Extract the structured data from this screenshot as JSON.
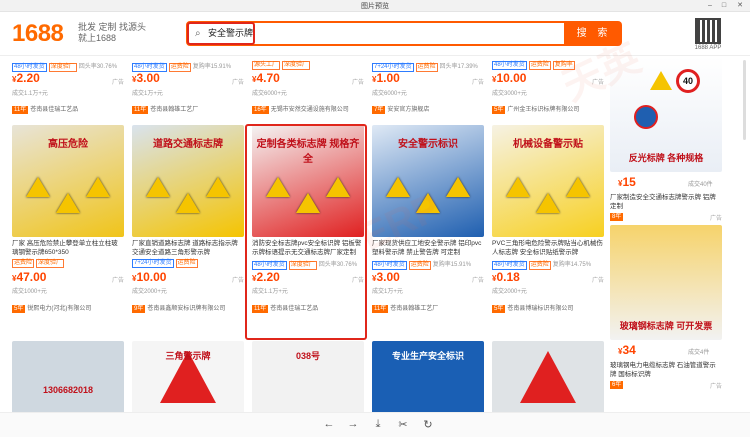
{
  "window": {
    "title": "图片预览"
  },
  "header": {
    "logo": "1688",
    "slogan": "批发 定制 找源头 就上1688",
    "search_value": "安全警示牌",
    "search_button": "搜 索",
    "qr_label": "1688 APP"
  },
  "row1": [
    {
      "price": "2.20",
      "sold": "成交1.1万+元",
      "shop": "苍南县佳瑞工艺品",
      "yr": "11年",
      "tags": [
        "48小时发货",
        "深度验厂",
        "回头率30.76%"
      ]
    },
    {
      "price": "3.00",
      "sold": "成交1万+元",
      "shop": "苍南县翰雄工艺厂",
      "yr": "11年",
      "tags": [
        "48小时发货",
        "运费险",
        "复购率15.91%"
      ]
    },
    {
      "price": "4.70",
      "sold": "成交6000+元",
      "shop": "无锡市安然交通设施有限公司",
      "yr": "16年",
      "tags": [
        "源头工厂",
        "深度验厂"
      ]
    },
    {
      "price": "1.00",
      "sold": "成交6000+元",
      "shop": "安安官方旗舰店",
      "yr": "7年",
      "tags": [
        "7+24小时发货",
        "运费险",
        "回头率17.39%"
      ]
    },
    {
      "price": "10.00",
      "sold": "成交3000+元",
      "shop": "广州金王标识标牌有限公司",
      "yr": "5年",
      "tags": [
        "48小时发货",
        "运费险",
        "复购率"
      ]
    }
  ],
  "row2": [
    {
      "title": "厂家 高压危险禁止攀登单立柱立柱玻璃钢警示牌650*350",
      "price": "47.00",
      "sold": "成交1000+元",
      "shop": "锐熙电力(河北)有限公司",
      "yr": "5年",
      "tags": [
        "运费险",
        "深度验厂"
      ],
      "img": "高压危险"
    },
    {
      "title": "厂家直销道路标志牌 道路标志指示牌 交通安全道路三角形警示牌",
      "price": "10.00",
      "sold": "成交2000+元",
      "shop": "苍南县鑫顺安标识牌有限公司",
      "yr": "9年",
      "tags": [
        "7+24小时发货",
        "运费险"
      ],
      "img": "道路交通标志牌"
    },
    {
      "title": "消防安全标志牌pvc安全标识牌 铝板警示牌标语提示无交通标志牌厂家定制",
      "price": "2.20",
      "sold": "成交1.1万+元",
      "shop": "苍南县佳瑞工艺品",
      "yr": "11年",
      "tags": [
        "48小时发货",
        "深度验厂",
        "回头率30.76%"
      ],
      "img": "定制各类标志牌 规格齐全"
    },
    {
      "title": "厂家现货供应工地安全警示牌 铝印pvc塑料警示牌 禁止警告牌 可定制",
      "price": "3.00",
      "sold": "成交1万+元",
      "shop": "苍南县翰雄工艺厂",
      "yr": "11年",
      "tags": [
        "48小时发货",
        "运费险",
        "复购率15.91%"
      ],
      "img": "安全警示标识"
    },
    {
      "title": "PVC三角形电危险警示牌贴当心机械伤人标志牌 安全标识贴纸警示牌",
      "price": "0.18",
      "sold": "成交2000+元",
      "shop": "苍南县博瑞标识有限公司",
      "yr": "5年",
      "tags": [
        "48小时发货",
        "运费险",
        "复购率14.75%"
      ],
      "img": "机械设备警示贴"
    }
  ],
  "rightcol": [
    {
      "price": "15",
      "sold": "成交40件",
      "title": "厂家制造安全交通标志牌警示牌 铝牌 定制",
      "yr": "8年",
      "img": "反光标牌 各种规格"
    },
    {
      "price": "34",
      "sold": "成交4件",
      "title": "玻璃钢电力电缆标志牌 石油管道警示牌 国标标识牌",
      "yr": "6年",
      "img": "玻璃钢标志牌 可开发票"
    }
  ],
  "row3_img": [
    "1306682018",
    "三角警示牌",
    "038号",
    "专业生产安全标识",
    ""
  ]
}
